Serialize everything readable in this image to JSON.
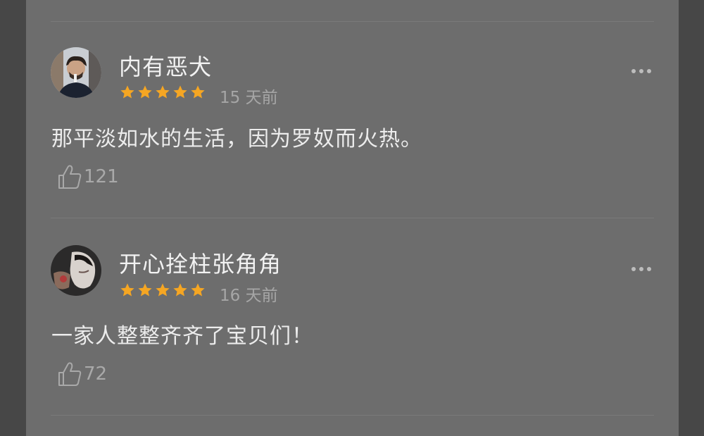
{
  "comments": [
    {
      "username": "内有恶犬",
      "rating": 5,
      "time": "15 天前",
      "text": "那平淡如水的生活，因为罗奴而火热。",
      "likes": "121"
    },
    {
      "username": "开心拴柱张角角",
      "rating": 5,
      "time": "16 天前",
      "text": "一家人整整齐齐了宝贝们！",
      "likes": "72"
    }
  ],
  "icons": {
    "star": "star-icon",
    "more": "more-icon",
    "like": "thumbs-up-icon"
  },
  "colors": {
    "background": "#474747",
    "panel": "#6d6d6d",
    "star": "#f5a623",
    "text": "#ececec",
    "muted": "#a6a6a6"
  }
}
